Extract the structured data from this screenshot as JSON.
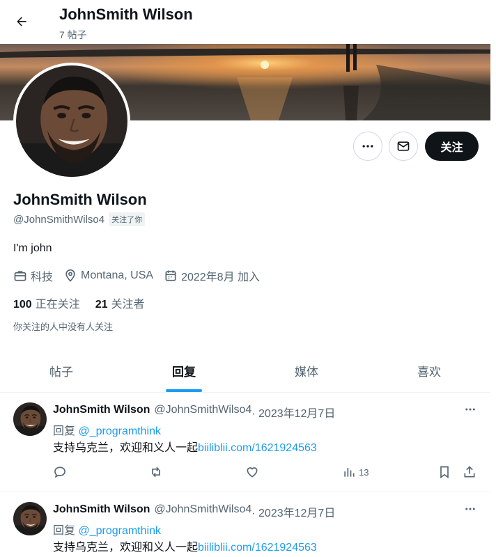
{
  "header": {
    "title": "JohnSmith Wilson",
    "post_count": "7 帖子"
  },
  "profile": {
    "name": "JohnSmith Wilson",
    "handle": "@JohnSmithWilso4",
    "follows_you": "关注了你",
    "bio": "I'm john",
    "category": "科技",
    "location": "Montana, USA",
    "joined": "2022年8月 加入",
    "following_count": "100",
    "following_label": "正在关注",
    "followers_count": "21",
    "followers_label": "关注者",
    "not_followed_note": "你关注的人中没有人关注",
    "follow_button": "关注"
  },
  "tabs": [
    {
      "label": "帖子",
      "active": false
    },
    {
      "label": "回复",
      "active": true
    },
    {
      "label": "媒体",
      "active": false
    },
    {
      "label": "喜欢",
      "active": false
    }
  ],
  "posts": [
    {
      "author": "JohnSmith Wilson",
      "handle": "@JohnSmithWilso4",
      "date": " · 2023年12月7日",
      "reply_prefix": "回复 ",
      "reply_to": "@_programthink",
      "text": "支持乌克兰，欢迎和义人一起",
      "link": "biiliblii.com/1621924563",
      "views": "13"
    },
    {
      "author": "JohnSmith Wilson",
      "handle": "@JohnSmithWilso4",
      "date": " · 2023年12月7日",
      "reply_prefix": "回复 ",
      "reply_to": "@_programthink",
      "text": "支持乌克兰，欢迎和义人一起",
      "link": "biiliblii.com/1621924563"
    }
  ],
  "colors": {
    "accent": "#1d9bf0",
    "text": "#0f1419",
    "muted": "#536471",
    "follow_bg": "#0f1419"
  }
}
